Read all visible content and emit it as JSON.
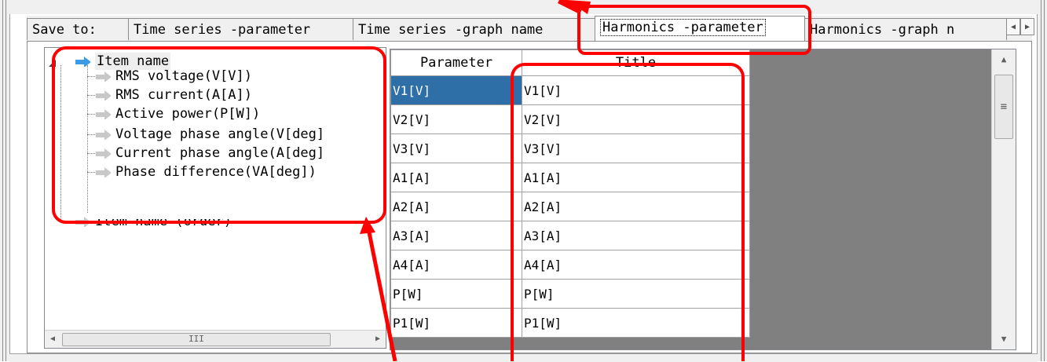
{
  "tabs": {
    "save_to": "Save to:",
    "items": [
      {
        "label": "Time series -parameter"
      },
      {
        "label": "Time series -graph name"
      },
      {
        "label": "Harmonics -parameter",
        "active": true
      },
      {
        "label": "Harmonics -graph n"
      }
    ],
    "scroll_left": "◀",
    "scroll_right": "▶"
  },
  "tree": {
    "root": {
      "label": "Item name",
      "expanded": true,
      "children": [
        {
          "label": "RMS voltage(V[V])"
        },
        {
          "label": "RMS current(A[A])"
        },
        {
          "label": "Active power(P[W])"
        },
        {
          "label": "Voltage phase angle(V[deg]"
        },
        {
          "label": "Current phase angle(A[deg]"
        },
        {
          "label": "Phase difference(VA[deg])"
        }
      ]
    },
    "second": {
      "label": "Item name (order)"
    },
    "hscroll_left": "◀",
    "hscroll_right": "▶",
    "hscroll_grip": "III"
  },
  "grid": {
    "headers": [
      "Parameter",
      "Title"
    ],
    "rows": [
      {
        "parameter": "V1[V]",
        "title": "V1[V]",
        "selected": true
      },
      {
        "parameter": "V2[V]",
        "title": "V2[V]"
      },
      {
        "parameter": "V3[V]",
        "title": "V3[V]"
      },
      {
        "parameter": "A1[A]",
        "title": "A1[A]"
      },
      {
        "parameter": "A2[A]",
        "title": "A2[A]"
      },
      {
        "parameter": "A3[A]",
        "title": "A3[A]"
      },
      {
        "parameter": "A4[A]",
        "title": "A4[A]"
      },
      {
        "parameter": "P[W]",
        "title": "P[W]"
      },
      {
        "parameter": "P1[W]",
        "title": "P1[W]"
      }
    ],
    "vscroll_up": "▲",
    "vscroll_down": "▼",
    "vscroll_grip": "≡"
  },
  "colors": {
    "annotation": "#ff0000",
    "selection": "#2f6fa8",
    "grid_background": "#808080",
    "tree_arrow_active": "#3a9be8",
    "tree_arrow_inactive": "#c8c8c8"
  }
}
